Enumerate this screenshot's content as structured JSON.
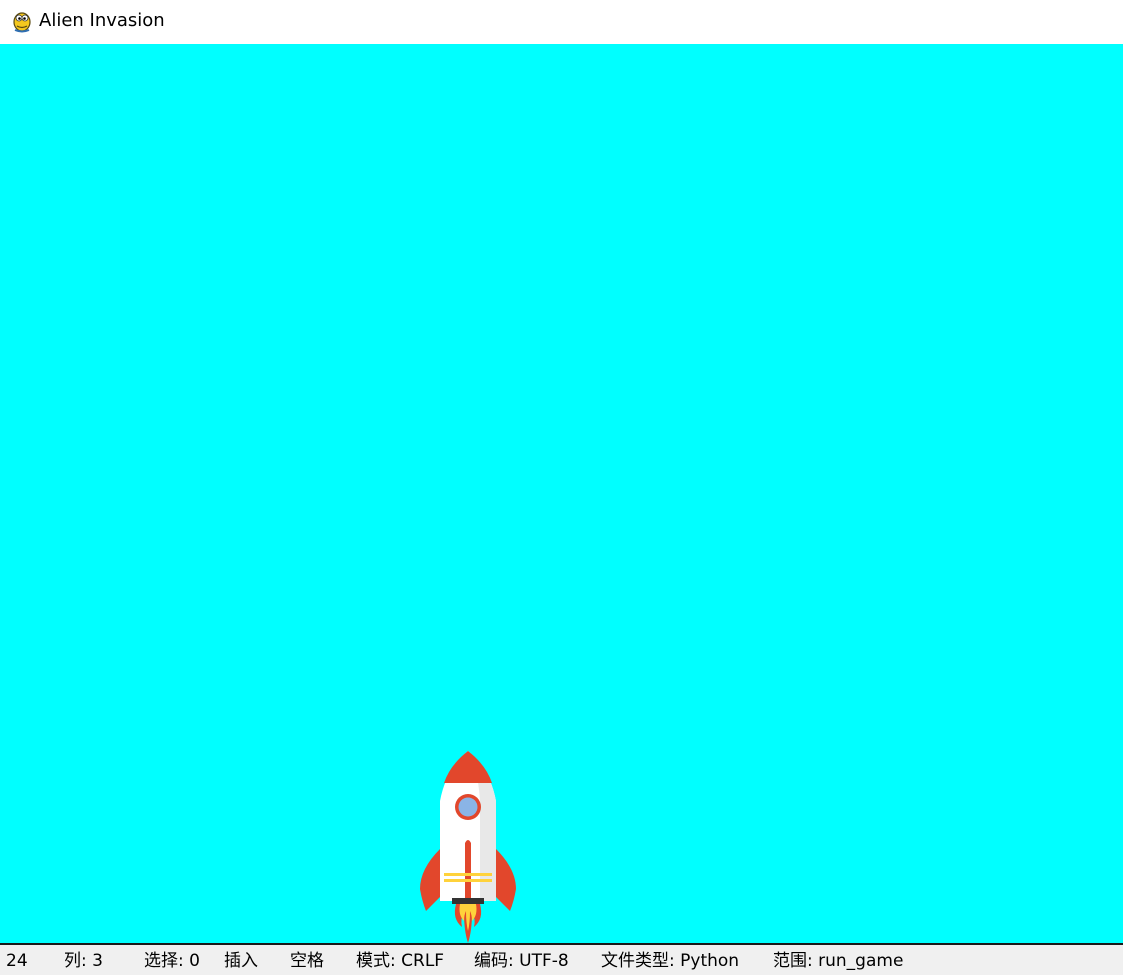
{
  "window": {
    "title": "Alien Invasion",
    "icon": "pygame-snake-icon"
  },
  "game": {
    "background_color": "#00ffff",
    "ship": {
      "name": "rocket-ship",
      "body_color": "#ffffff",
      "accent_color": "#e2472c",
      "window_color": "#8ab4e6",
      "flame_color": "#ffd23b"
    }
  },
  "statusbar": {
    "line": "24",
    "column": "列: 3",
    "selection": "选择: 0",
    "insert_mode": "插入",
    "indent": "空格",
    "line_endings": "模式: CRLF",
    "encoding": "编码: UTF-8",
    "file_type": "文件类型: Python",
    "scope": "范围: run_game"
  }
}
